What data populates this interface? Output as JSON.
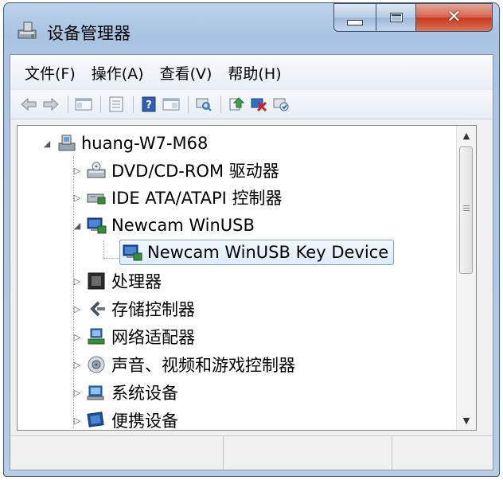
{
  "window": {
    "title": "设备管理器"
  },
  "menu": {
    "file": "文件(F)",
    "action": "操作(A)",
    "view": "查看(V)",
    "help": "帮助(H)"
  },
  "toolbar": {
    "buttons": [
      "back-icon",
      "forward-icon",
      "console-tree-icon",
      "properties-icon",
      "help-icon",
      "export-icon",
      "scan-hardware-icon",
      "update-driver-icon",
      "uninstall-icon",
      "enable-device-icon"
    ]
  },
  "tree": {
    "root": "huang-W7-M68",
    "items": [
      {
        "label": "DVD/CD-ROM 驱动器",
        "expanded": false,
        "icon": "dvd-drive-icon"
      },
      {
        "label": "IDE ATA/ATAPI 控制器",
        "expanded": false,
        "icon": "ide-controller-icon"
      },
      {
        "label": "Newcam WinUSB",
        "expanded": true,
        "icon": "usb-device-icon",
        "children": [
          {
            "label": "Newcam WinUSB Key Device",
            "selected": true,
            "icon": "usb-device-icon"
          }
        ]
      },
      {
        "label": "处理器",
        "expanded": false,
        "icon": "processor-icon"
      },
      {
        "label": "存储控制器",
        "expanded": false,
        "icon": "storage-controller-icon"
      },
      {
        "label": "网络适配器",
        "expanded": false,
        "icon": "network-adapter-icon"
      },
      {
        "label": "声音、视频和游戏控制器",
        "expanded": false,
        "icon": "sound-icon"
      },
      {
        "label": "系统设备",
        "expanded": false,
        "icon": "system-device-icon"
      },
      {
        "label": "便携设备",
        "expanded": false,
        "icon": "portable-device-icon"
      }
    ]
  },
  "colors": {
    "frame": "#b7cde6",
    "selection_border": "#7da2ce",
    "close_button": "#c8351d"
  }
}
